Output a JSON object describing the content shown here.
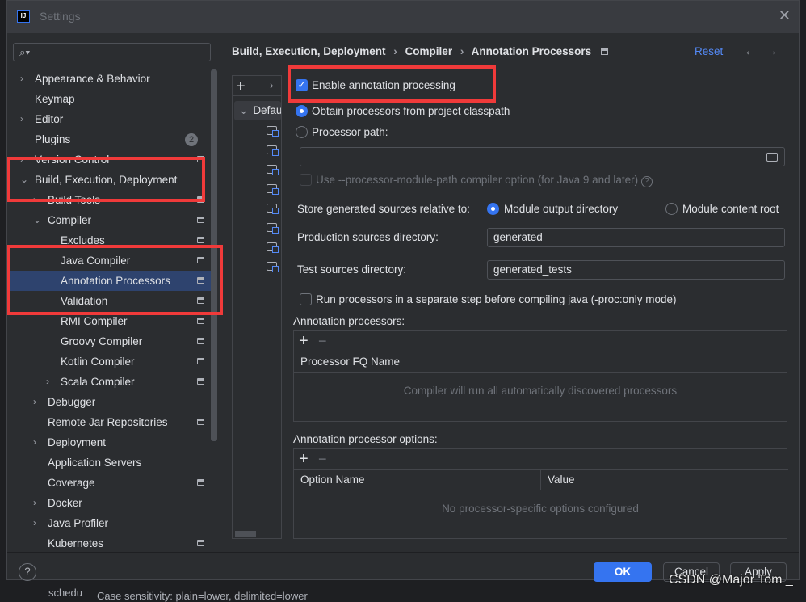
{
  "window": {
    "title": "Settings",
    "logo": "IJ"
  },
  "search": {
    "placeholder": ""
  },
  "sidebar": {
    "items": [
      {
        "label": "Appearance & Behavior",
        "expandable": true
      },
      {
        "label": "Keymap"
      },
      {
        "label": "Editor",
        "expandable": true
      },
      {
        "label": "Plugins",
        "badge": "2"
      },
      {
        "label": "Version Control",
        "expandable": true
      },
      {
        "label": "Build, Execution, Deployment",
        "expanded": true
      },
      {
        "label": "Build Tools",
        "expandable": true
      },
      {
        "label": "Compiler",
        "expanded": true
      },
      {
        "label": "Excludes"
      },
      {
        "label": "Java Compiler"
      },
      {
        "label": "Annotation Processors",
        "selected": true
      },
      {
        "label": "Validation"
      },
      {
        "label": "RMI Compiler"
      },
      {
        "label": "Groovy Compiler"
      },
      {
        "label": "Kotlin Compiler"
      },
      {
        "label": "Scala Compiler",
        "expandable": true
      },
      {
        "label": "Debugger",
        "expandable": true
      },
      {
        "label": "Remote Jar Repositories"
      },
      {
        "label": "Deployment",
        "expandable": true
      },
      {
        "label": "Application Servers"
      },
      {
        "label": "Coverage"
      },
      {
        "label": "Docker",
        "expandable": true
      },
      {
        "label": "Java Profiler",
        "expandable": true
      },
      {
        "label": "Kubernetes"
      }
    ]
  },
  "breadcrumb": [
    "Build, Execution, Deployment",
    "Compiler",
    "Annotation Processors"
  ],
  "header": {
    "reset": "Reset",
    "back": "←",
    "forward": "→"
  },
  "profiles": {
    "add": "+",
    "more": "›",
    "default": "Defau"
  },
  "settings": {
    "enable_annotation_processing": {
      "label": "Enable annotation processing",
      "checked": true
    },
    "obtain_from_classpath": {
      "label": "Obtain processors from project classpath",
      "selected": true
    },
    "processor_path": {
      "label": "Processor path:",
      "value": ""
    },
    "module_path_option": {
      "label": "Use --processor-module-path compiler option (for Java 9 and later)",
      "checked": false
    },
    "store_generated": {
      "label": "Store generated sources relative to:",
      "options": [
        "Module output directory",
        "Module content root"
      ],
      "selected": "Module output directory"
    },
    "production_dir": {
      "label": "Production sources directory:",
      "value": "generated"
    },
    "test_dir": {
      "label": "Test sources directory:",
      "value": "generated_tests"
    },
    "separate_step": {
      "label": "Run processors in a separate step before compiling java (-proc:only mode)",
      "checked": false
    }
  },
  "annotation_processors": {
    "title": "Annotation processors:",
    "column": "Processor FQ Name",
    "empty": "Compiler will run all automatically discovered processors"
  },
  "processor_options": {
    "title": "Annotation processor options:",
    "columns": [
      "Option Name",
      "Value"
    ],
    "empty": "No processor-specific options configured"
  },
  "footer": {
    "help": "?",
    "ok": "OK",
    "cancel": "Cancel",
    "apply": "Apply"
  },
  "background": {
    "status_text": "Case sensitivity: plain=lower, delimited=lower",
    "item": "schedu"
  },
  "watermark": "CSDN @Major Tom _",
  "colors": {
    "accent": "#3574f0",
    "highlight": "#f03a3a",
    "link": "#548af7"
  }
}
